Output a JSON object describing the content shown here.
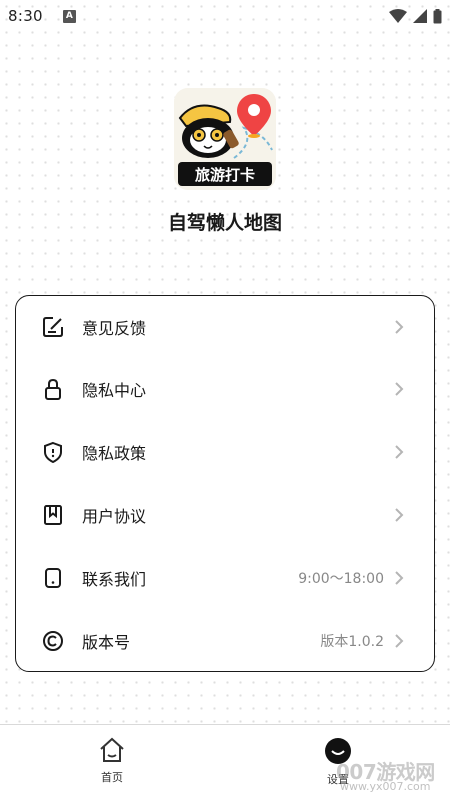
{
  "status_bar": {
    "time": "8:30",
    "indicator": "A"
  },
  "app": {
    "name": "自驾懒人地图",
    "logo_text": "旅游打卡"
  },
  "menu": {
    "items": [
      {
        "label": "意见反馈",
        "icon": "edit-icon",
        "value": ""
      },
      {
        "label": "隐私中心",
        "icon": "lock-icon",
        "value": ""
      },
      {
        "label": "隐私政策",
        "icon": "shield-icon",
        "value": ""
      },
      {
        "label": "用户协议",
        "icon": "bookmark-icon",
        "value": ""
      },
      {
        "label": "联系我们",
        "icon": "phone-icon",
        "value": "9:00～18:00"
      },
      {
        "label": "版本号",
        "icon": "copyright-icon",
        "value": "版本1.0.2"
      }
    ]
  },
  "tabs": [
    {
      "label": "首页",
      "icon": "home-icon"
    },
    {
      "label": "设置",
      "icon": "settings-icon"
    }
  ],
  "watermark": {
    "text": "007游戏网",
    "url": "www.yx007.com"
  },
  "colors": {
    "border": "#1a1a1a",
    "secondary_text": "#888888",
    "arrow": "#b5b5b5",
    "pin": "#ef4444"
  }
}
